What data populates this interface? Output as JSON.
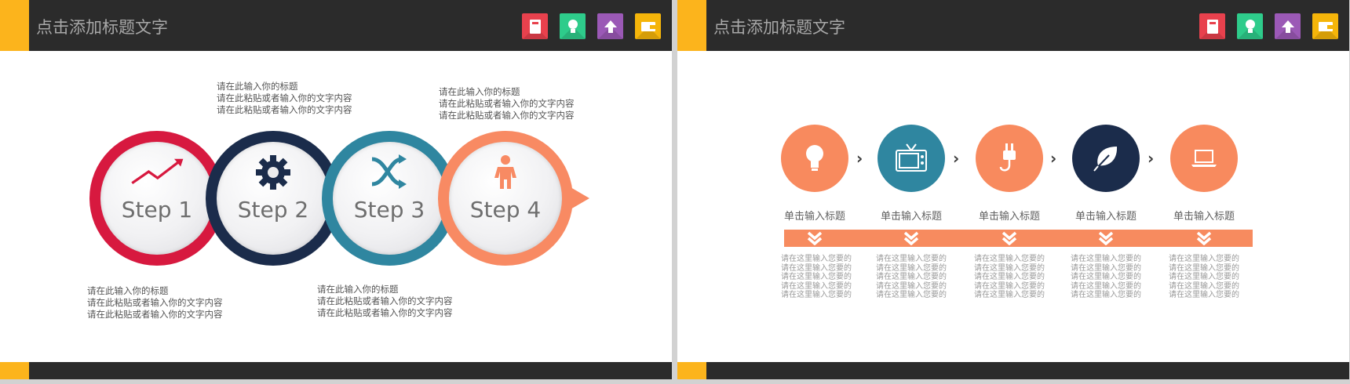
{
  "slide_title": "点击添加标题文字",
  "header_icons": [
    {
      "name": "book-icon",
      "color": "#e8414d"
    },
    {
      "name": "lightbulb-icon",
      "color": "#2ecc8b"
    },
    {
      "name": "upload-arrow-icon",
      "color": "#9b59b6"
    },
    {
      "name": "wallet-icon",
      "color": "#f5b50a"
    }
  ],
  "steps": [
    {
      "label": "Step 1",
      "color": "#d7193f",
      "icon": "trend-up-icon"
    },
    {
      "label": "Step 2",
      "color": "#1b2c4b",
      "icon": "gear-icon"
    },
    {
      "label": "Step 3",
      "color": "#2f86a0",
      "icon": "shuffle-icon"
    },
    {
      "label": "Step 4",
      "color": "#f88a63",
      "icon": "person-icon"
    }
  ],
  "step_texts": [
    {
      "title": "请在此输入你的标题",
      "line1": "请在此粘贴或者输入你的文字内容",
      "line2": "请在此粘贴或者输入你的文字内容"
    },
    {
      "title": "请在此输入你的标题",
      "line1": "请在此粘贴或者输入你的文字内容",
      "line2": "请在此粘贴或者输入你的文字内容"
    },
    {
      "title": "请在此输入你的标题",
      "line1": "请在此粘贴或者输入你的文字内容",
      "line2": "请在此粘贴或者输入你的文字内容"
    },
    {
      "title": "请在此输入你的标题",
      "line1": "请在此粘贴或者输入你的文字内容",
      "line2": "请在此粘贴或者输入你的文字内容"
    }
  ],
  "flow": [
    {
      "title": "单击输入标题",
      "icon": "lightbulb-icon",
      "color": "#f88a5e",
      "desc": "请在这里输入您要的请在这里输入您要的请在这里输入您要的请在这里输入您要的请在这里输入您要的"
    },
    {
      "title": "单击输入标题",
      "icon": "tv-icon",
      "color": "#2f86a0",
      "desc": "请在这里输入您要的请在这里输入您要的请在这里输入您要的请在这里输入您要的请在这里输入您要的"
    },
    {
      "title": "单击输入标题",
      "icon": "plug-icon",
      "color": "#f88a5e",
      "desc": "请在这里输入您要的请在这里输入您要的请在这里输入您要的请在这里输入您要的请在这里输入您要的"
    },
    {
      "title": "单击输入标题",
      "icon": "leaf-icon",
      "color": "#1b2c4b",
      "desc": "请在这里输入您要的请在这里输入您要的请在这里输入您要的请在这里输入您要的请在这里输入您要的"
    },
    {
      "title": "单击输入标题",
      "icon": "laptop-icon",
      "color": "#f88a5e",
      "desc": "请在这里输入您要的请在这里输入您要的请在这里输入您要的请在这里输入您要的请在这里输入您要的"
    }
  ],
  "colors": {
    "header_bg": "#2b2b2b",
    "accent": "#fcb41c",
    "flow_bar": "#f78b5f"
  }
}
